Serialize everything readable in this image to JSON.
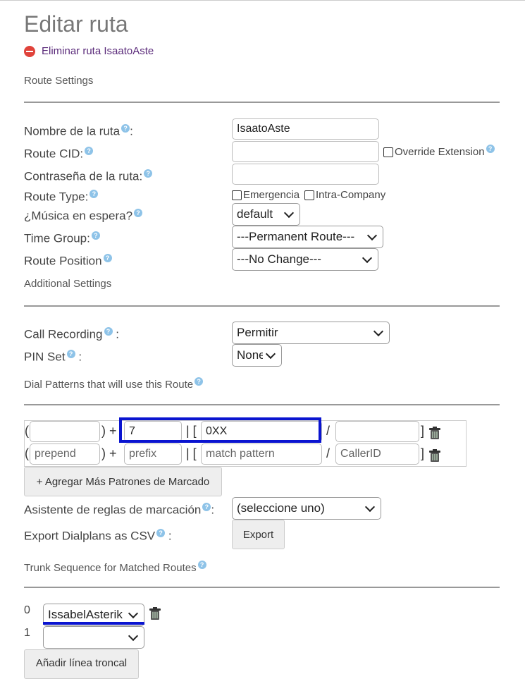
{
  "page": {
    "title": "Editar ruta",
    "delete_link": "Eliminar ruta IsaatoAste"
  },
  "sections": {
    "route_settings": "Route Settings",
    "additional_settings": "Additional Settings",
    "dial_patterns": "Dial Patterns that will use this Route",
    "trunk_sequence": "Trunk Sequence for Matched Routes"
  },
  "fields": {
    "route_name_label": "Nombre de la ruta",
    "route_name_value": "IsaatoAste",
    "route_cid_label": "Route CID:",
    "override_extension_label": "Override Extension",
    "route_password_label": "Contraseña de la ruta:",
    "route_type_label": "Route Type:",
    "emergency_label": "Emergencia",
    "intra_company_label": "Intra-Company",
    "music_on_hold_label": "¿Música en espera?",
    "music_on_hold_value": "default",
    "time_group_label": "Time Group:",
    "time_group_value": "---Permanent Route---",
    "route_position_label": "Route Position",
    "route_position_value": "---No Change---",
    "call_recording_label": "Call Recording",
    "call_recording_value": "Permitir",
    "pin_set_label": "PIN Set",
    "pin_set_value": "None",
    "colon": ":"
  },
  "dial_patterns": {
    "rows": [
      {
        "prepend": "",
        "prefix": "7",
        "match": "0XX",
        "callerid": ""
      },
      {
        "prepend": "",
        "prefix": "",
        "match": "",
        "callerid": ""
      }
    ],
    "placeholders": {
      "prepend": "prepend",
      "prefix": "prefix",
      "match": "match pattern",
      "callerid": "CallerID"
    },
    "sep_open": "(",
    "sep_close_plus": ") +",
    "sep_bracket": "| [",
    "sep_slash": "/",
    "sep_end": "]",
    "add_more_button": "+ Agregar Más Patrones de Marcado",
    "wizard_label": "Asistente de reglas de marcación",
    "wizard_value": "(seleccione uno)",
    "export_label": "Export Dialplans as CSV",
    "export_button": "Export"
  },
  "trunks": {
    "rows": [
      {
        "index": "0",
        "value": "IssabelAsterik"
      },
      {
        "index": "1",
        "value": ""
      }
    ],
    "add_button": "Añadir línea troncal"
  },
  "colors": {
    "highlight": "#0a14d0",
    "help_icon": "#8ec3e8",
    "delete_icon": "#e0433b"
  }
}
